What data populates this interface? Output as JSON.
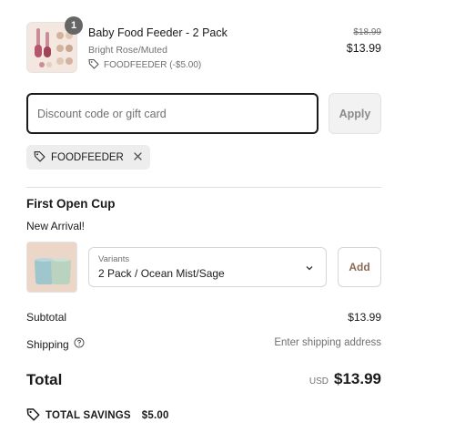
{
  "line_item": {
    "quantity": "1",
    "title": "Baby Food Feeder - 2 Pack",
    "variant": "Bright Rose/Muted",
    "discount_code_note": "FOODFEEDER (-$5.00)",
    "original_price": "$18.99",
    "price": "$13.99",
    "icon": "tag-icon"
  },
  "discount": {
    "placeholder": "Discount code or gift card",
    "apply_label": "Apply",
    "applied_code": "FOODFEEDER",
    "remove_icon": "close-icon"
  },
  "upsell": {
    "title": "First Open Cup",
    "subtitle": "New Arrival!",
    "variant_label": "Variants",
    "variant_value": "2 Pack / Ocean Mist/Sage",
    "add_label": "Add"
  },
  "summary": {
    "subtotal_label": "Subtotal",
    "subtotal_value": "$13.99",
    "shipping_label": "Shipping",
    "shipping_value": "Enter shipping address",
    "total_label": "Total",
    "currency": "USD",
    "total_value": "$13.99",
    "savings_label": "TOTAL SAVINGS",
    "savings_value": "$5.00"
  },
  "colors": {
    "primary_text": "#1a1a1a",
    "muted_text": "#707070",
    "badge": "#666666",
    "add_button_text": "#8a6a55"
  }
}
